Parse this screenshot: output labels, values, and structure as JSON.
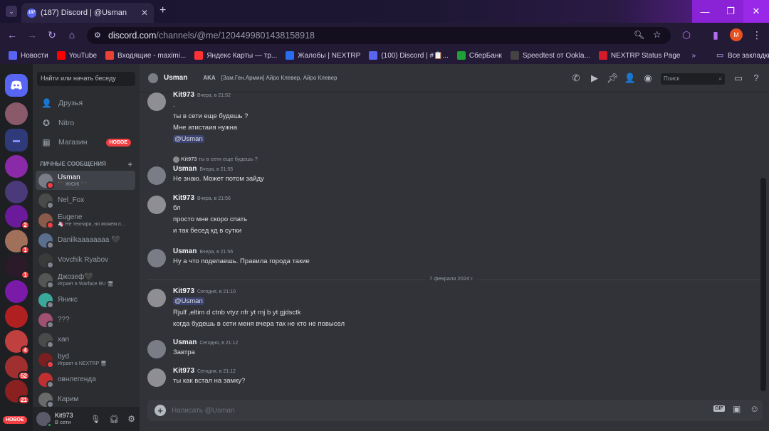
{
  "browser": {
    "tab_title": "(187) Discord | @Usman",
    "tab_badge": "187",
    "url_host": "discord.com",
    "url_path": "/channels/@me/1204499801438158918",
    "profile_initial": "M",
    "bookmarks": [
      {
        "label": "Новости",
        "icon": "news-icon",
        "color": "#5865f2"
      },
      {
        "label": "YouTube",
        "icon": "youtube-icon",
        "color": "#ff0000"
      },
      {
        "label": "Входящие - maximi...",
        "icon": "gmail-icon",
        "color": "#ea4335"
      },
      {
        "label": "Яндекс Карты — тр...",
        "icon": "map-pin-icon",
        "color": "#ff3333"
      },
      {
        "label": "Жалобы | NEXTRP",
        "icon": "nextrp-icon",
        "color": "#2a6ef0"
      },
      {
        "label": "(100) Discord | #📋...",
        "icon": "discord-icon",
        "color": "#5865f2"
      },
      {
        "label": "СберБанк",
        "icon": "sber-icon",
        "color": "#21a038"
      },
      {
        "label": "Speedtest от Ookla...",
        "icon": "speedtest-icon",
        "color": "#444444"
      },
      {
        "label": "NEXTRP Status Page",
        "icon": "status-icon",
        "color": "#d11b2a"
      }
    ],
    "bookmarks_more": "»",
    "all_bookmarks": "Все закладки"
  },
  "sidebar": {
    "badges": [
      "2",
      "1",
      "1",
      "4",
      "52",
      "21"
    ],
    "new_label": "НОВОЕ"
  },
  "dm_panel": {
    "search_placeholder": "Найти или начать беседу",
    "nav": [
      {
        "label": "Друзья",
        "icon": "friends-icon"
      },
      {
        "label": "Nitro",
        "icon": "nitro-icon"
      },
      {
        "label": "Магазин",
        "icon": "shop-icon",
        "badge": "НОВОЕ"
      }
    ],
    "header": "ЛИЧНЫЕ СООБЩЕНИЯ",
    "add": "+",
    "items": [
      {
        "name": "Usman",
        "sub": "🖤 ЖЮЖ 🖤",
        "status": "#f23f43",
        "color": "#7a7d86",
        "active": true
      },
      {
        "name": "Nel_Fox",
        "sub": "",
        "status": "#80848e",
        "color": "#4a4a4a"
      },
      {
        "name": "Eugene",
        "sub": "🦄 Не технари, но можем п...",
        "status": "#f23f43",
        "color": "#8a5a4a"
      },
      {
        "name": "Danilkaaaaaaaa 🖤",
        "sub": "",
        "status": "#80848e",
        "color": "#5a6e90"
      },
      {
        "name": "Vovchik Ryabov",
        "sub": "",
        "status": "#80848e",
        "color": "#3a3a3a"
      },
      {
        "name": "Джозеф🖤",
        "sub": "Играет в Warface RU 🖥",
        "status": "#80848e",
        "color": "#555555"
      },
      {
        "name": "Яникс",
        "sub": "",
        "status": "#80848e",
        "color": "#3aa89a"
      },
      {
        "name": "???",
        "sub": "",
        "status": "#80848e",
        "color": "#a05070"
      },
      {
        "name": "xan",
        "sub": "",
        "status": "#80848e",
        "color": "#4a4a4a"
      },
      {
        "name": "byd",
        "sub": "Играет в NEXTRP 🖥",
        "status": "#f23f43",
        "color": "#7a2020"
      },
      {
        "name": "овнлегенда",
        "sub": "",
        "status": "#80848e",
        "color": "#c03030"
      },
      {
        "name": "Карим",
        "sub": "",
        "status": "#80848e",
        "color": "#6a6a6a"
      }
    ]
  },
  "user": {
    "name": "Kit973",
    "status": "В сети"
  },
  "chat": {
    "recipient": "Usman",
    "aka_label": "AKA",
    "aka_names": "[Зам.Ген.Армии] Айро Клевер, Айро Клевер",
    "search_placeholder": "Поиск",
    "reply_preview_author": "Kit973",
    "reply_preview_text": "ты в сети еще будешь ?",
    "date_divider": "7 февраля 2024 г.",
    "composer_placeholder": "Написать @Usman",
    "messages": [
      {
        "author": "Kit973",
        "time": "Вчера, в 21:52",
        "lines": [
          ".",
          "ты в сети еще будешь ?",
          "Мне атистаия нужна",
          "@Usman"
        ]
      },
      {
        "author": "Usman",
        "time": "Вчера, в 21:55",
        "lines": [
          "Не знаю. Может потом зайду"
        ]
      },
      {
        "author": "Kit973",
        "time": "Вчера, в 21:56",
        "lines": [
          "бл",
          "просто мне скоро спать",
          "и так бесед кд в сутки"
        ]
      },
      {
        "author": "Usman",
        "time": "Вчера, в 21:56",
        "lines": [
          "Ну а что поделаешь. Правила города такие"
        ]
      },
      {
        "author": "Kit973",
        "time": "Сегодня, в 21:10",
        "lines": [
          "@Usman",
          "Rjulf ,eltim d ctnb vtyz nfr yt rnj b yt gjdsctk",
          "когда будешь в сети меня вчера так не кто не повысел"
        ]
      },
      {
        "author": "Usman",
        "time": "Сегодня, в 21:12",
        "lines": [
          "Завтра"
        ]
      },
      {
        "author": "Kit973",
        "time": "Сегодня, в 21:12",
        "lines": [
          "ты как встал на замку?"
        ]
      }
    ]
  }
}
